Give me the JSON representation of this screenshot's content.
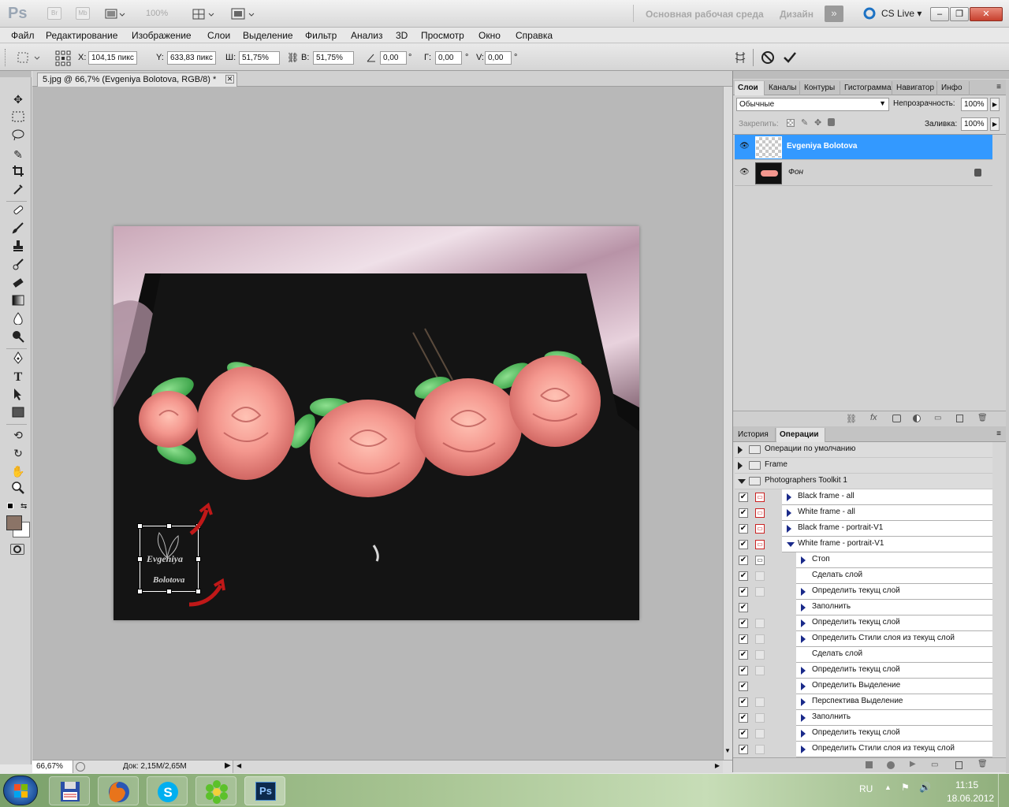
{
  "app": {
    "logo": "Ps",
    "bridge_btn": "Br",
    "minibridge_btn": "Mb",
    "zoom_level": "100%",
    "workspace_main": "Основная рабочая среда",
    "workspace_design": "Дизайн",
    "cs_live": "CS Live"
  },
  "menu": [
    "Файл",
    "Редактирование",
    "Изображение",
    "Слои",
    "Выделение",
    "Фильтр",
    "Анализ",
    "3D",
    "Просмотр",
    "Окно",
    "Справка"
  ],
  "options": {
    "x_label": "X:",
    "x_value": "104,15 пикс",
    "y_label": "Y:",
    "y_value": "633,83 пикс",
    "w_label": "Ш:",
    "w_value": "51,75%",
    "h_label": "В:",
    "h_value": "51,75%",
    "angle_value": "0,00",
    "hskew_label": "Г:",
    "hskew_value": "0,00",
    "vskew_label": "V:",
    "vskew_value": "0,00",
    "degree": "°"
  },
  "document": {
    "tab_title": "5.jpg @ 66,7% (Evgeniya Bolotova, RGB/8) *",
    "watermark_line1": "Evgeniya",
    "watermark_line2": "Bolotova"
  },
  "status": {
    "zoom": "66,67%",
    "doc_size": "Док: 2,15M/2,65M"
  },
  "layers_panel": {
    "tabs": [
      "Слои",
      "Каналы",
      "Контуры",
      "Гистограмма",
      "Навигатор",
      "Инфо"
    ],
    "blend_mode": "Обычные",
    "opacity_label": "Непрозрачность:",
    "opacity_value": "100%",
    "lock_label": "Закрепить:",
    "fill_label": "Заливка:",
    "fill_value": "100%",
    "layers": [
      {
        "name": "Evgeniya Bolotova",
        "selected": true,
        "locked": false
      },
      {
        "name": "Фон",
        "selected": false,
        "locked": true
      }
    ]
  },
  "actions_panel": {
    "tabs": [
      "История",
      "Операции"
    ],
    "rows": [
      {
        "label": "Операции по умолчанию",
        "level": 0,
        "type": "folder",
        "expanded": false,
        "dialog": "red",
        "checked": true
      },
      {
        "label": "Frame",
        "level": 0,
        "type": "folder",
        "expanded": false,
        "dialog": "red",
        "checked": true
      },
      {
        "label": "Photographers Toolkit 1",
        "level": 0,
        "type": "folder",
        "expanded": true,
        "dialog": "red",
        "checked": true
      },
      {
        "label": "Black frame - all",
        "level": 1,
        "type": "action",
        "expanded": false,
        "dialog": "red",
        "checked": true
      },
      {
        "label": "White frame - all",
        "level": 1,
        "type": "action",
        "expanded": false,
        "dialog": "red",
        "checked": true
      },
      {
        "label": "Black frame - portrait-V1",
        "level": 1,
        "type": "action",
        "expanded": false,
        "dialog": "red",
        "checked": true
      },
      {
        "label": "White frame - portrait-V1",
        "level": 1,
        "type": "action",
        "expanded": true,
        "dialog": "red",
        "checked": true
      },
      {
        "label": "Стоп",
        "level": 2,
        "type": "step",
        "expanded": false,
        "dialog": "on",
        "checked": true
      },
      {
        "label": "Сделать слой",
        "level": 2,
        "type": "step-plain",
        "expanded": false,
        "dialog": "off",
        "checked": true
      },
      {
        "label": "Определить текущ слой",
        "level": 2,
        "type": "step",
        "expanded": false,
        "dialog": "off",
        "checked": true
      },
      {
        "label": "Заполнить",
        "level": 2,
        "type": "step",
        "expanded": false,
        "dialog": "none",
        "checked": true
      },
      {
        "label": "Определить текущ слой",
        "level": 2,
        "type": "step",
        "expanded": false,
        "dialog": "off",
        "checked": true
      },
      {
        "label": "Определить Стили слоя из текущ слой",
        "level": 2,
        "type": "step",
        "expanded": false,
        "dialog": "off",
        "checked": true
      },
      {
        "label": "Сделать слой",
        "level": 2,
        "type": "step-plain",
        "expanded": false,
        "dialog": "off",
        "checked": true
      },
      {
        "label": "Определить текущ слой",
        "level": 2,
        "type": "step",
        "expanded": false,
        "dialog": "off",
        "checked": true
      },
      {
        "label": "Определить Выделение",
        "level": 2,
        "type": "step",
        "expanded": false,
        "dialog": "none",
        "checked": true
      },
      {
        "label": "Перспектива Выделение",
        "level": 2,
        "type": "step",
        "expanded": false,
        "dialog": "off",
        "checked": true
      },
      {
        "label": "Заполнить",
        "level": 2,
        "type": "step",
        "expanded": false,
        "dialog": "off",
        "checked": true
      },
      {
        "label": "Определить текущ слой",
        "level": 2,
        "type": "step",
        "expanded": false,
        "dialog": "off",
        "checked": true
      },
      {
        "label": "Определить Стили слоя из текущ слой",
        "level": 2,
        "type": "step",
        "expanded": false,
        "dialog": "off",
        "checked": true
      }
    ]
  },
  "taskbar": {
    "language": "RU",
    "time": "11:15",
    "date": "18.06.2012",
    "ps_label": "Ps"
  },
  "colors": {
    "selected_layer": "#3399ff",
    "rose": "#f4978e",
    "leaf": "#4fbf5a",
    "foreground_swatch": "#8b7467"
  }
}
